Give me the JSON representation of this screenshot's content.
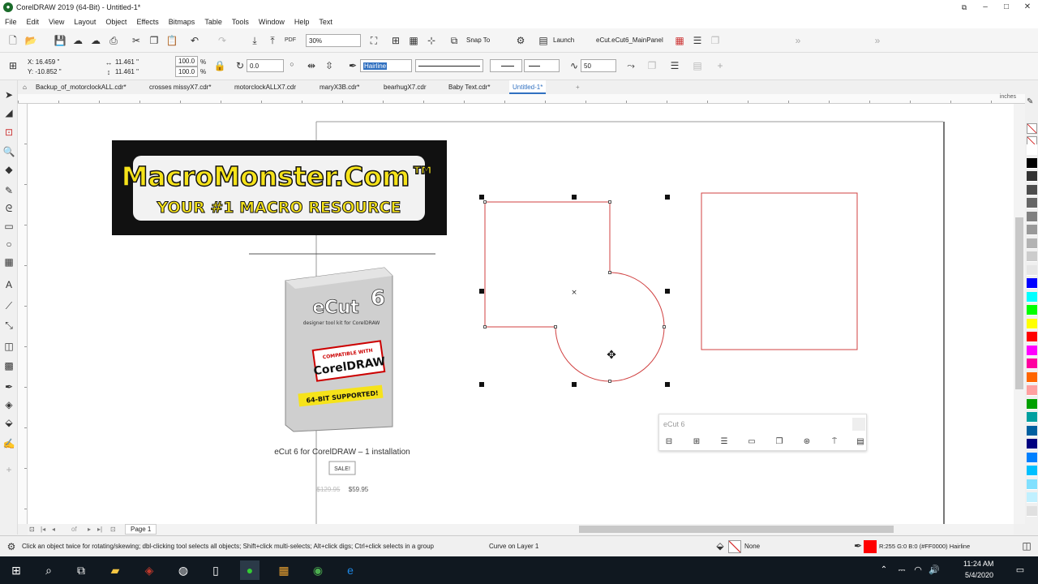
{
  "app": {
    "title": "CorelDRAW 2019 (64-Bit) - Untitled-1*",
    "window_controls": [
      "–",
      "□",
      "✕"
    ]
  },
  "menu": [
    "File",
    "Edit",
    "View",
    "Layout",
    "Object",
    "Effects",
    "Bitmaps",
    "Table",
    "Tools",
    "Window",
    "Help",
    "Text"
  ],
  "standard_toolbar": {
    "zoom_value": "30%",
    "snap_to": "Snap To",
    "launch": "Launch",
    "macro": "eCut.eCut6_MainPanel"
  },
  "property_bar": {
    "x": "X: 16.459 \"",
    "y": "Y: -10.852 \"",
    "width": "11.461 \"",
    "height": "11.461 \"",
    "scale_w": "100.0",
    "scale_h": "100.0",
    "scale_unit": "%",
    "rotation": "0.0",
    "outline_width": "Hairline",
    "smoothing": "50"
  },
  "doc_tabs": [
    {
      "label": "Backup_of_motorclockALL.cdr*"
    },
    {
      "label": "crosses missyX7.cdr*"
    },
    {
      "label": "motorclockALLX7.cdr"
    },
    {
      "label": "maryX3B.cdr*"
    },
    {
      "label": "bearhugX7.cdr"
    },
    {
      "label": "Baby Text.cdr*"
    },
    {
      "label": "Untitled-1*"
    }
  ],
  "ruler_units": "inches",
  "canvas": {
    "banner": {
      "line1": "MacroMonster.Com™",
      "line2": "YOUR #1 MACRO RESOURCE"
    },
    "product": {
      "box_brand": "eCut",
      "box_version": "6",
      "box_tagline": "designer tool kit for CorelDRAW",
      "box_compat": "COMPATIBLE WITH",
      "box_corel": "CorelDRAW",
      "box_64bit": "64-BIT SUPPORTED!",
      "name": "eCut 6 for CorelDRAW – 1 installation",
      "badge": "SALE!",
      "old_price": "$129.95",
      "new_price": "$59.95"
    },
    "ecut_panel_title": "eCut 6"
  },
  "page_nav": {
    "of": "of",
    "page_tab": "Page 1"
  },
  "status": {
    "hint": "Click an object twice for rotating/skewing; dbl-clicking tool selects all objects; Shift+click multi-selects; Alt+click digs; Ctrl+click selects in a group",
    "object_info": "Curve on Layer 1",
    "fill_label": "None",
    "outline_info": "R:255 G:0 B:0 (#FF0000)  Hairline"
  },
  "taskbar": {
    "time": "11:24 AM",
    "date": "5/4/2020"
  },
  "colors": {
    "outline_red": "#ff0000",
    "shape_stroke": "#d04040",
    "banner_yellow": "#f6e31a",
    "accent_blue": "#3070c0"
  },
  "palette": [
    "#ffffff",
    "#000000",
    "#333333",
    "#4d4d4d",
    "#666666",
    "#808080",
    "#999999",
    "#b3b3b3",
    "#cccccc",
    "#e6e6e6",
    "#0000ff",
    "#00ffff",
    "#00ff00",
    "#ffff00",
    "#ff0000",
    "#ff00ff",
    "#ff00a0",
    "#ff6600",
    "#ffa0a0",
    "#00a000",
    "#00a0a0",
    "#0060a0",
    "#000080",
    "#0080ff",
    "#00c0ff",
    "#80e0ff",
    "#c0f0ff",
    "#e0e0e0"
  ]
}
